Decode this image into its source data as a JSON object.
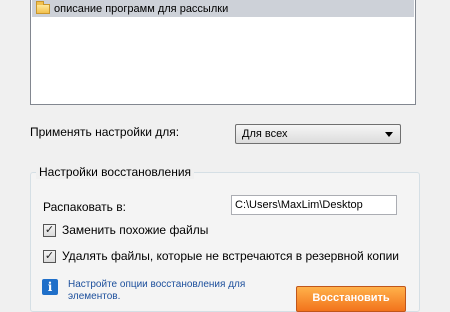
{
  "program_list": {
    "items": [
      {
        "label": "описание программ для рассылки",
        "icon": "folder-icon",
        "selected": true
      }
    ]
  },
  "apply_settings": {
    "label": "Применять настройки для:",
    "selected_option": "Для всех"
  },
  "restore_settings": {
    "title": "Настройки восстановления",
    "unpack_label": "Распаковать в:",
    "unpack_path": "C:\\Users\\MaxLim\\Desktop",
    "replace_similar": {
      "label": "Заменить похожие файлы",
      "checked": true
    },
    "delete_missing": {
      "label": "Удалять файлы, которые не встречаются в резервной копии",
      "checked": true
    },
    "info_text": "Настройте опции восстановления для элементов.",
    "info_icon": "info-icon",
    "restore_button": "Восстановить"
  },
  "colors": {
    "selection": "#cdd1d8",
    "accent_button": "#f2731c",
    "info_link": "#1c4f9c"
  }
}
